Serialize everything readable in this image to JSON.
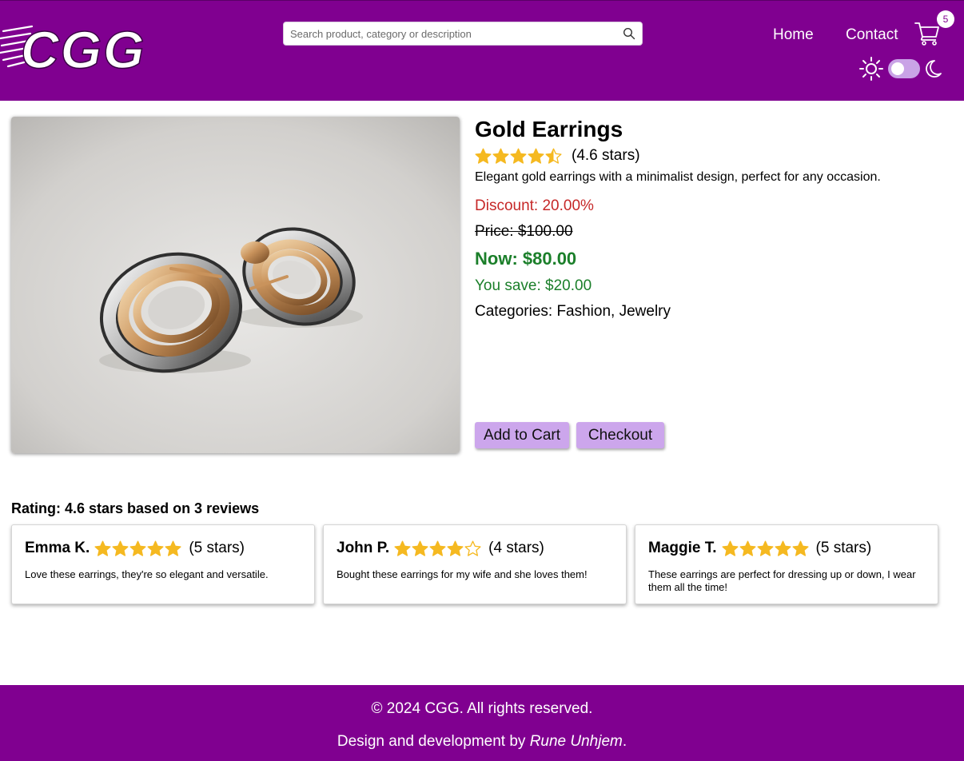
{
  "header": {
    "logo_text": "CGG",
    "search_placeholder": "Search product, category or description",
    "nav": {
      "home": "Home",
      "contact": "Contact"
    },
    "cart_count": "5",
    "theme_mode": "light"
  },
  "product": {
    "title": "Gold Earrings",
    "rating_value": 4.6,
    "rating_text": "(4.6 stars)",
    "description": "Elegant gold earrings with a minimalist design, perfect for any occasion.",
    "discount": "Discount: 20.00%",
    "price_old": "Price: $100.00",
    "price_now": "Now: $80.00",
    "you_save": "You save: $20.00",
    "categories": "Categories: Fashion, Jewelry",
    "add_to_cart_label": "Add to Cart",
    "checkout_label": "Checkout"
  },
  "reviews": {
    "summary": "Rating: 4.6 stars based on 3 reviews",
    "items": [
      {
        "name": "Emma K.",
        "stars": 5,
        "stars_text": "(5 stars)",
        "body": "Love these earrings, they're so elegant and versatile."
      },
      {
        "name": "John P.",
        "stars": 4,
        "stars_text": "(4 stars)",
        "body": "Bought these earrings for my wife and she loves them!"
      },
      {
        "name": "Maggie T.",
        "stars": 5,
        "stars_text": "(5 stars)",
        "body": "These earrings are perfect for dressing up or down, I wear them all the time!"
      }
    ]
  },
  "footer": {
    "copyright": "© 2024 CGG. All rights reserved.",
    "credit_prefix": "Design and development by ",
    "credit_name": "Rune Unhjem",
    "credit_suffix": "."
  },
  "colors": {
    "brand": "#800090",
    "button": "#cca6ec",
    "star": "#f5b921",
    "discount": "#c62828",
    "savings": "#1b7f2a"
  }
}
